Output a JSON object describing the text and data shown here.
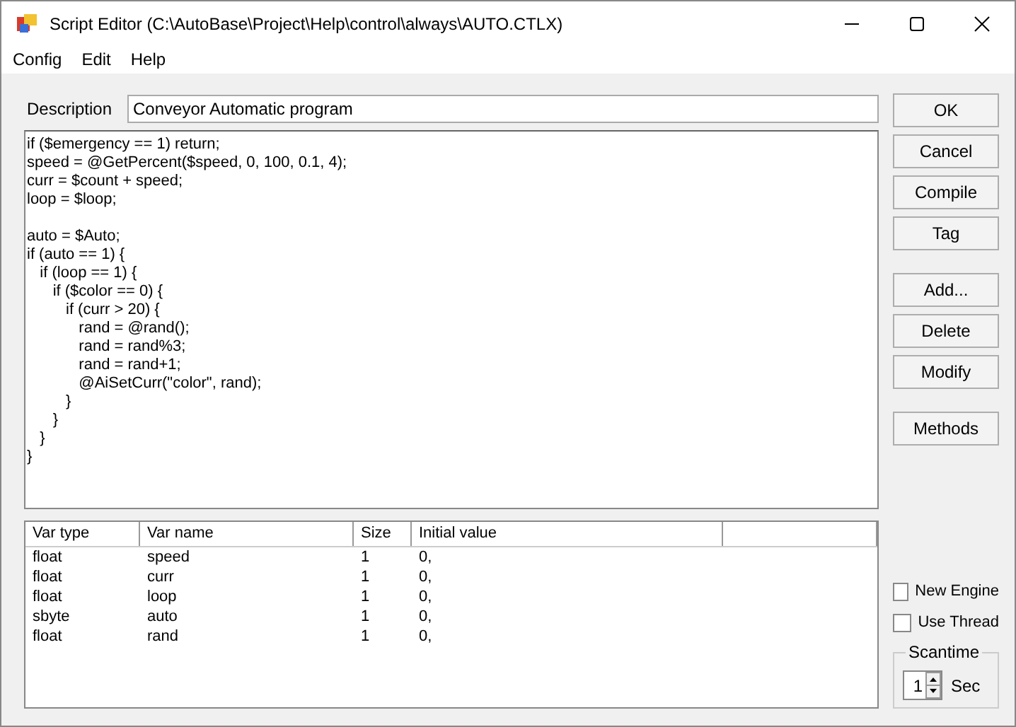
{
  "window": {
    "title": "Script Editor (C:\\AutoBase\\Project\\Help\\control\\always\\AUTO.CTLX)"
  },
  "menu": [
    "Config",
    "Edit",
    "Help"
  ],
  "description": {
    "label": "Description",
    "value": "Conveyor Automatic program"
  },
  "code": [
    [
      "if ($emergency == 1) return;",
      "speed = @GetPercent($speed, 0, 100, 0.1, 4);",
      "curr = $count + speed;",
      "loop = $loop;"
    ],
    [
      "auto = $Auto;",
      "if (auto == 1) {",
      "   if (loop == 1) {",
      "      if ($color == 0) {",
      "         if (curr > 20) {",
      "            rand = @rand();",
      "            rand = rand%3;",
      "            rand = rand+1;",
      "            @AiSetCurr(\"color\", rand);",
      "         }",
      "      }",
      "   }",
      "}"
    ]
  ],
  "table": {
    "columns": [
      "Var type",
      "Var name",
      "Size",
      "Initial value"
    ],
    "rows": [
      [
        "float",
        "speed",
        "1",
        "0,"
      ],
      [
        "float",
        "curr",
        "1",
        "0,"
      ],
      [
        "float",
        "loop",
        "1",
        "0,"
      ],
      [
        "sbyte",
        "auto",
        "1",
        "0,"
      ],
      [
        "float",
        "rand",
        "1",
        "0,"
      ]
    ]
  },
  "button_groups": [
    [
      "OK",
      "Cancel",
      "Compile",
      "Tag"
    ],
    [
      "Add...",
      "Delete",
      "Modify"
    ],
    [
      "Methods"
    ]
  ],
  "options": [
    {
      "label": "New Engine",
      "checked": false
    },
    {
      "label": "Use Thread",
      "checked": false
    }
  ],
  "scantime": {
    "title": "Scantime",
    "value": "1",
    "unit": "Sec"
  }
}
